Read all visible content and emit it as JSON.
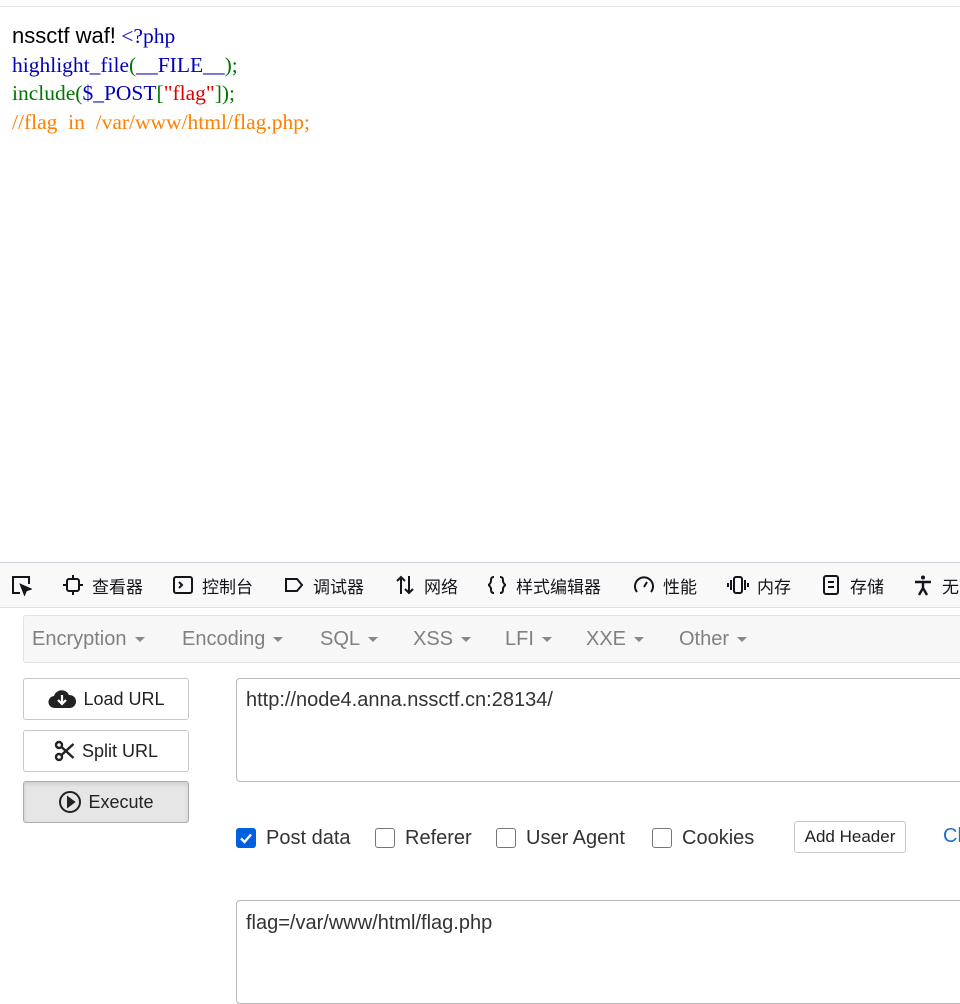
{
  "page": {
    "title": "nssctf waf!",
    "code_lines": [
      [
        {
          "text": "<?php",
          "color": "blue"
        }
      ],
      [
        {
          "text": "highlight_file",
          "color": "blue"
        },
        {
          "text": "(",
          "color": "green"
        },
        {
          "text": "__FILE__",
          "color": "blue"
        },
        {
          "text": ");",
          "color": "green"
        }
      ],
      [
        {
          "text": "include(",
          "color": "green"
        },
        {
          "text": "$_POST",
          "color": "blue"
        },
        {
          "text": "[",
          "color": "green"
        },
        {
          "text": "\"flag\"",
          "color": "red"
        },
        {
          "text": "]);",
          "color": "green"
        }
      ],
      [
        {
          "text": "//flag  in  /var/www/html/flag.php;",
          "color": "orange"
        }
      ]
    ]
  },
  "devtools": {
    "tabs": [
      {
        "icon": "element-picker-icon",
        "label": ""
      },
      {
        "icon": "inspector-icon",
        "label": "查看器"
      },
      {
        "icon": "console-icon",
        "label": "控制台"
      },
      {
        "icon": "debugger-icon",
        "label": "调试器"
      },
      {
        "icon": "network-icon",
        "label": "网络"
      },
      {
        "icon": "style-editor-icon",
        "label": "样式编辑器"
      },
      {
        "icon": "performance-icon",
        "label": "性能"
      },
      {
        "icon": "memory-icon",
        "label": "内存"
      },
      {
        "icon": "storage-icon",
        "label": "存储"
      },
      {
        "icon": "accessibility-icon",
        "label": "无"
      }
    ]
  },
  "hackbar": {
    "menu": [
      "Encryption",
      "Encoding",
      "SQL",
      "XSS",
      "LFI",
      "XXE",
      "Other"
    ],
    "buttons": {
      "load": "Load URL",
      "split": "Split URL",
      "execute": "Execute"
    },
    "url_value": "http://node4.anna.nssctf.cn:28134/",
    "options": [
      {
        "label": "Post data",
        "checked": true
      },
      {
        "label": "Referer",
        "checked": false
      },
      {
        "label": "User Agent",
        "checked": false
      },
      {
        "label": "Cookies",
        "checked": false
      }
    ],
    "add_header": "Add Header",
    "clear_all": "Cl",
    "post_value": "flag=/var/www/html/flag.php"
  },
  "colors": {
    "blue": "#0000bb",
    "green": "#007700",
    "red": "#dd0000",
    "orange": "#ff8000",
    "check": "#0060df"
  }
}
